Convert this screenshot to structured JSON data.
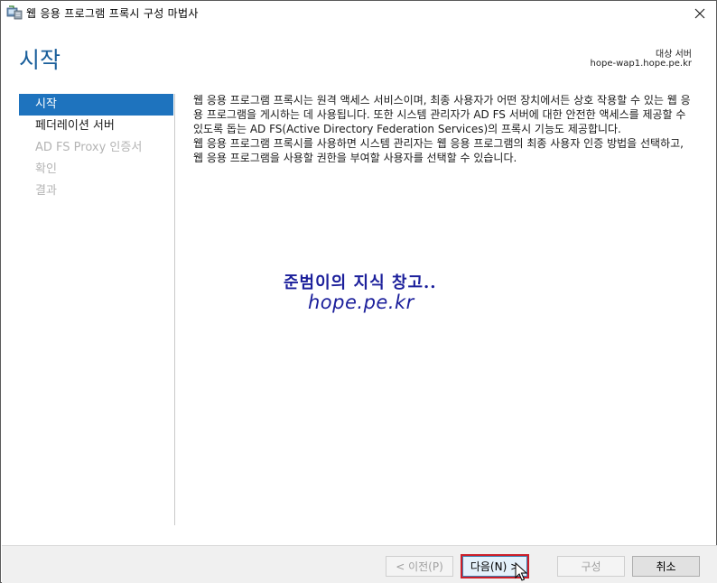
{
  "window": {
    "title": "웹 응용 프로그램 프록시 구성 마법사",
    "close_icon": "close-icon"
  },
  "header": {
    "page_title": "시작",
    "server_label": "대상 서버",
    "server_name": "hope-wap1.hope.pe.kr"
  },
  "sidebar": {
    "items": [
      {
        "label": "시작",
        "state": "active"
      },
      {
        "label": "페더레이션 서버",
        "state": "enabled"
      },
      {
        "label": "AD FS Proxy 인증서",
        "state": "disabled"
      },
      {
        "label": "확인",
        "state": "disabled"
      },
      {
        "label": "결과",
        "state": "disabled"
      }
    ]
  },
  "content": {
    "paragraph1": "웹 응용 프로그램 프록시는 원격 액세스 서비스이며, 최종 사용자가 어떤 장치에서든 상호 작용할 수 있는 웹 응용 프로그램을 게시하는 데 사용됩니다. 또한 시스템 관리자가 AD FS 서버에 대한 안전한 액세스를 제공할 수 있도록 돕는 AD FS(Active Directory Federation Services)의 프록시 기능도 제공합니다.",
    "paragraph2": "웹 응용 프로그램 프록시를 사용하면 시스템 관리자는 웹 응용 프로그램의 최종 사용자 인증 방법을 선택하고, 웹 응용 프로그램을 사용할 권한을 부여할 사용자를 선택할 수 있습니다."
  },
  "watermark": {
    "line1": "준범이의 지식 창고..",
    "line2": "hope.pe.kr"
  },
  "footer": {
    "prev_label": "< 이전(P)",
    "next_label": "다음(N) >",
    "install_label": "구성",
    "cancel_label": "취소"
  },
  "colors": {
    "accent": "#1e73be",
    "title_blue": "#1a5f9b",
    "highlight_border": "#cc1f2a",
    "watermark": "#1b1f9b"
  }
}
